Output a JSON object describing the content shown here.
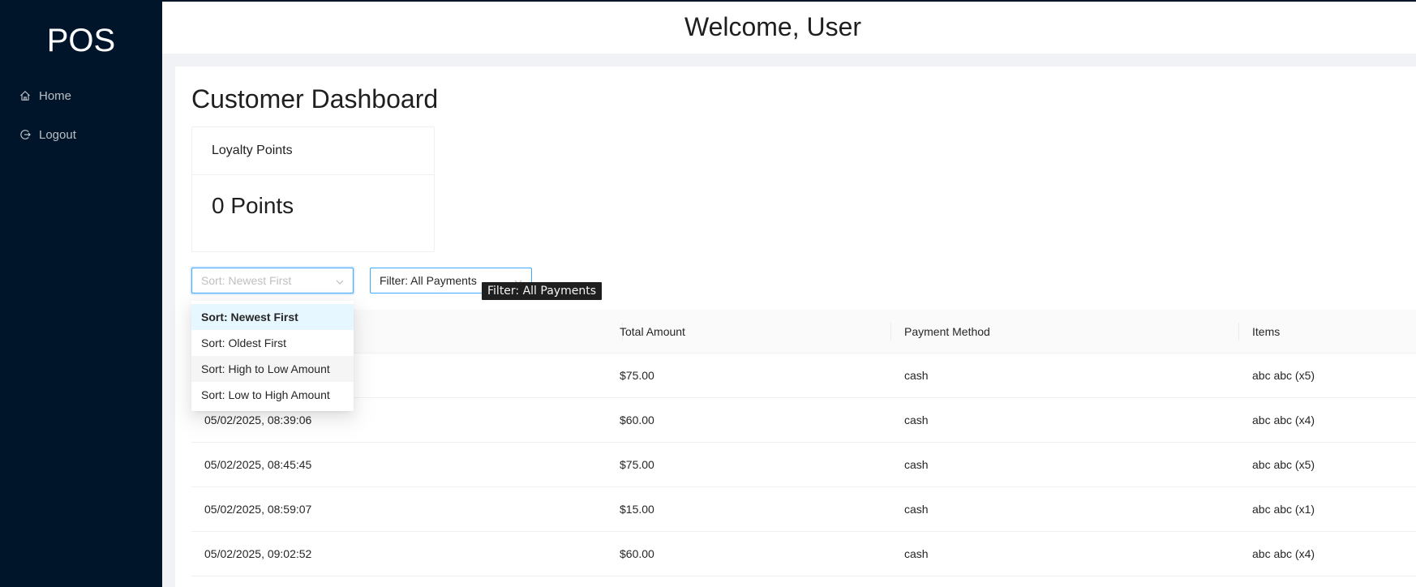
{
  "sidebar": {
    "logo": "POS",
    "items": [
      {
        "label": "Home",
        "icon": "home-icon"
      },
      {
        "label": "Logout",
        "icon": "logout-icon"
      }
    ]
  },
  "header": {
    "welcome": "Welcome, User"
  },
  "main": {
    "title": "Customer Dashboard",
    "loyalty": {
      "title": "Loyalty Points",
      "value": "0 Points"
    },
    "sort": {
      "placeholder": "Sort: Newest First",
      "options": [
        "Sort: Newest First",
        "Sort: Oldest First",
        "Sort: High to Low Amount",
        "Sort: Low to High Amount"
      ]
    },
    "filter": {
      "value": "Filter: All Payments",
      "tooltip": "Filter: All Payments"
    },
    "table": {
      "columns": [
        "",
        "Total Amount",
        "Payment Method",
        "Items"
      ],
      "rows": [
        [
          "",
          "$75.00",
          "cash",
          "abc abc (x5)"
        ],
        [
          "05/02/2025, 08:39:06",
          "$60.00",
          "cash",
          "abc abc (x4)"
        ],
        [
          "05/02/2025, 08:45:45",
          "$75.00",
          "cash",
          "abc abc (x5)"
        ],
        [
          "05/02/2025, 08:59:07",
          "$15.00",
          "cash",
          "abc abc (x1)"
        ],
        [
          "05/02/2025, 09:02:52",
          "$60.00",
          "cash",
          "abc abc (x4)"
        ]
      ]
    }
  },
  "colors": {
    "sidebar": "#001529",
    "accent": "#40a9ff",
    "selected_option": "#e6f7ff"
  }
}
